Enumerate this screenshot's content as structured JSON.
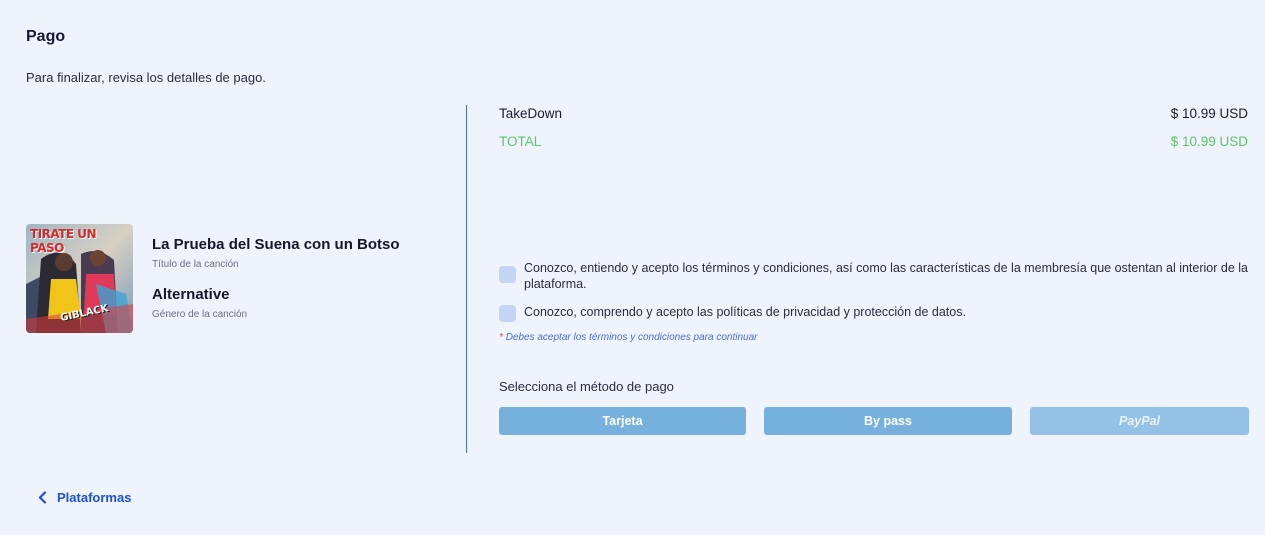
{
  "header": {
    "title": "Pago",
    "subtitle": "Para finalizar, revisa los detalles de pago."
  },
  "song": {
    "cover_text": "TIRATE UN PASO",
    "cover_artist": "GIBLACK",
    "title": "La Prueba del Suena con un Botso",
    "title_label": "Título de la canción",
    "genre": "Alternative",
    "genre_label": "Género de la canción"
  },
  "summary": {
    "item_name": "TakeDown",
    "item_price": "$ 10.99 USD",
    "total_label": "TOTAL",
    "total_price": "$ 10.99 USD",
    "total_color": "#5cc46c"
  },
  "terms": {
    "checkbox1_text": "Conozco, entiendo y acepto los términos y condiciones, así como las características de la membresía que ostentan al interior de la plataforma.",
    "checkbox1_checked": false,
    "checkbox2_text": "Conozco, comprendo y acepto las políticas de privacidad y protección de datos.",
    "checkbox2_checked": false,
    "warning_star": "*",
    "warning_text": "Debes aceptar los términos y condiciones para continuar"
  },
  "payment": {
    "label": "Selecciona el método de pago",
    "methods": [
      {
        "label": "Tarjeta"
      },
      {
        "label": "By pass"
      },
      {
        "label": "PayPal"
      }
    ]
  },
  "navigation": {
    "back_label": "Plataformas",
    "back_icon": "chevron-left-icon"
  },
  "colors": {
    "accent": "#1e4fd8",
    "divider": "#4a6fd1",
    "button": "#76b0dd",
    "button_disabled": "#94c1e6",
    "background": "#eff3fc"
  }
}
